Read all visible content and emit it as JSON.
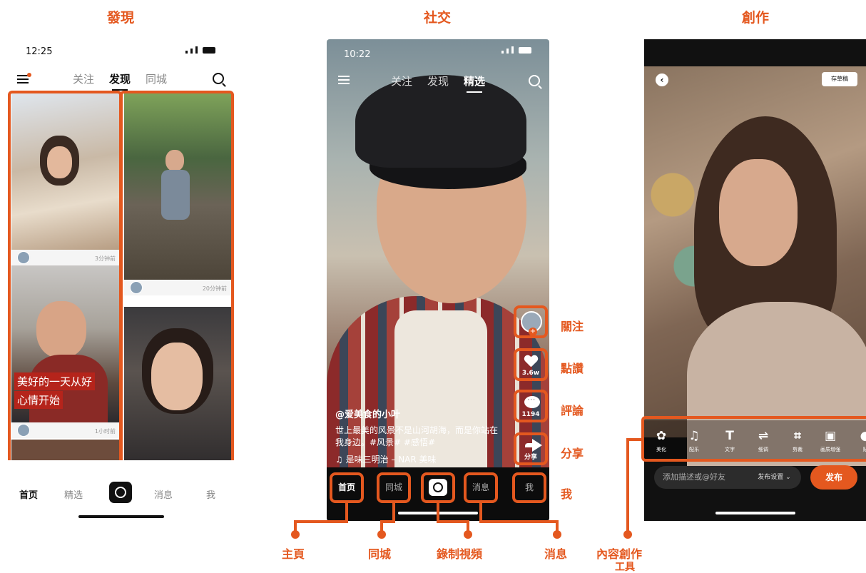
{
  "sections": {
    "discover_title": "發現",
    "social_title": "社交",
    "create_title": "創作"
  },
  "phone1": {
    "time": "12:25",
    "tabs": [
      "关注",
      "发现",
      "同城"
    ],
    "active_tab": "发现",
    "cards": [
      {
        "time_ago": "3分钟前"
      },
      {
        "time_ago": "20分钟前"
      },
      {
        "time_ago": "1小时前",
        "caption_line1": "美好的一天从好",
        "caption_line2": "心情开始"
      }
    ],
    "bottom_nav": [
      "首页",
      "精选",
      "消息",
      "我"
    ]
  },
  "phone2": {
    "time": "10:22",
    "tabs": [
      "关注",
      "发现",
      "精选"
    ],
    "active_tab": "精选",
    "likes": "3.6w",
    "comments": "1194",
    "share": "分享",
    "username": "@爱美食的小叶",
    "description": "世上最美的风景不是山河胡海，而是你站在我身边。#风景# #感悟#",
    "music": "♫ 是味三明治 – NAR  美味",
    "bottom_nav": [
      "首页",
      "同城",
      "消息",
      "我"
    ]
  },
  "annotations": {
    "follow": "關注",
    "like": "點讚",
    "comment": "評論",
    "share": "分享",
    "me": "我",
    "home": "主頁",
    "nearby": "同城",
    "record": "錄制視頻",
    "messages": "消息",
    "tools_line1": "內容創作",
    "tools_line2": "工具"
  },
  "phone3": {
    "draft": "存草稿",
    "tools": [
      {
        "icon": "beautify-icon",
        "label": "美化",
        "glyph": "✿"
      },
      {
        "icon": "music-icon",
        "label": "配乐",
        "glyph": "♫"
      },
      {
        "icon": "text-icon",
        "label": "文字",
        "glyph": "T"
      },
      {
        "icon": "adjust-icon",
        "label": "细调",
        "glyph": "⇌"
      },
      {
        "icon": "crop-icon",
        "label": "剪裁",
        "glyph": "⌗"
      },
      {
        "icon": "enhance-icon",
        "label": "画质增强",
        "glyph": "▣"
      },
      {
        "icon": "sticker-icon",
        "label": "贴",
        "glyph": "●"
      }
    ],
    "input_placeholder": "添加描述或@好友",
    "publish_settings": "发布设置 ⌄",
    "publish": "发布"
  },
  "colors": {
    "accent": "#e4581f",
    "caption_bg": "#b5241b"
  }
}
